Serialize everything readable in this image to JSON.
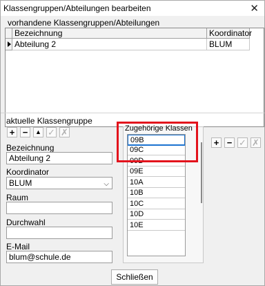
{
  "window": {
    "title": "Klassengruppen/Abteilungen bearbeiten",
    "close_glyph": "✕"
  },
  "group1": {
    "label": "vorhandene Klassengruppen/Abteilungen",
    "columns": [
      "Bezeichnung",
      "Koordinator"
    ],
    "rows": [
      {
        "bezeichnung": "Abteilung 2",
        "koordinator": "BLUM"
      }
    ]
  },
  "group2": {
    "label": "aktuelle Klassengruppe",
    "toolbar": {
      "add": "+",
      "remove": "−",
      "up": "▲",
      "check": "✓",
      "clear": "✗"
    },
    "fields": {
      "bezeichnung": {
        "label": "Bezeichnung",
        "value": "Abteilung 2"
      },
      "koordinator": {
        "label": "Koordinator",
        "value": "BLUM",
        "arrow": "⌵"
      },
      "raum": {
        "label": "Raum",
        "value": ""
      },
      "durchwahl": {
        "label": "Durchwahl",
        "value": ""
      },
      "email": {
        "label": "E-Mail",
        "value": "blum@schule.de"
      }
    }
  },
  "klassen": {
    "label": "Zugehörige Klassen",
    "items": [
      "09B",
      "09C",
      "09D",
      "09E",
      "10A",
      "10B",
      "10C",
      "10D",
      "10E"
    ],
    "selected_index": 0,
    "toolbar": {
      "add": "+",
      "remove": "−",
      "check": "✓",
      "clear": "✗"
    }
  },
  "footer": {
    "close_label": "Schließen"
  },
  "colors": {
    "highlight": "#e3121c",
    "selection": "#1a72d0"
  }
}
